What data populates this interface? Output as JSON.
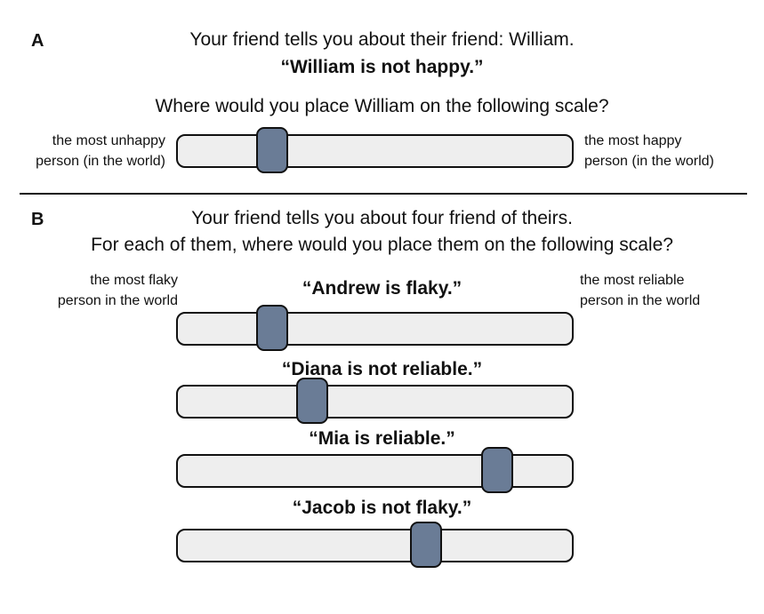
{
  "panel_a": {
    "label": "A",
    "intro": "Your friend tells you about their friend: William.",
    "quote": "“William is not happy.”",
    "question": "Where would you place William on the following scale?",
    "scale": {
      "left_label_line1": "the most unhappy",
      "left_label_line2": "person (in the world)",
      "right_label_line1": "the most happy",
      "right_label_line2": "person (in the world)"
    },
    "slider": {
      "value": 0.24
    }
  },
  "panel_b": {
    "label": "B",
    "intro": "Your friend tells you about four friend of theirs.",
    "question": "For each of them, where would you place them on the following scale?",
    "scale": {
      "left_label_line1": "the most flaky",
      "left_label_line2": "person in the world",
      "right_label_line1": "the most reliable",
      "right_label_line2": "person in the world"
    },
    "items": [
      {
        "quote": "“Andrew is flaky.”",
        "value": 0.24
      },
      {
        "quote": "“Diana is not reliable.”",
        "value": 0.34
      },
      {
        "quote": "“Mia is reliable.”",
        "value": 0.81
      },
      {
        "quote": "“Jacob is not flaky.”",
        "value": 0.63
      }
    ]
  },
  "colors": {
    "track_fill": "#eeeeee",
    "thumb_fill": "#6a7c96",
    "outline": "#111111"
  }
}
